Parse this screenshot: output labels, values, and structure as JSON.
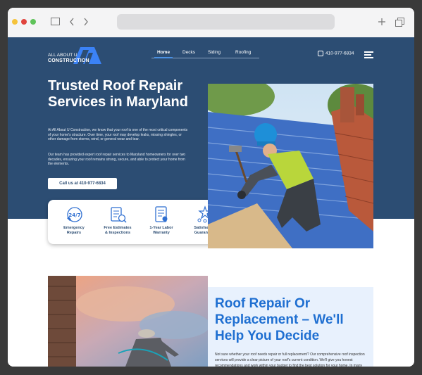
{
  "logo": {
    "line1": "ALL ABOUT U",
    "line2": "CONSTRUCTION"
  },
  "nav": {
    "items": [
      "Home",
      "Decks",
      "Siding",
      "Roofing"
    ]
  },
  "header": {
    "phone": "410-977-6834"
  },
  "hero": {
    "title": "Trusted Roof Repair Services in Maryland",
    "paragraph1": "At All About U Construction, we know that your roof is one of the most critical components of your home's structure. Over time, your roof may develop leaks, missing shingles, or other damage from storms, wind, or general wear and tear.",
    "paragraph2": "Our team has provided expert roof repair services to Maryland homeowners for over two decades, ensuring your roof remains strong, secure, and able to protect your home from the elements.",
    "cta_label": "Call us at 410-977-6834"
  },
  "features": [
    {
      "label": "Emergency\nRepairs",
      "icon": "24-7-phone-icon"
    },
    {
      "label": "Free Estimates\n& Inspections",
      "icon": "estimate-clipboard-icon"
    },
    {
      "label": "1-Year Labor\nWarranty",
      "icon": "warranty-document-icon"
    },
    {
      "label": "Satisfaction\nGuaranteed",
      "icon": "satisfaction-star-icon"
    }
  ],
  "section2": {
    "title": "Roof Repair Or Replacement – We'll Help You Decide",
    "paragraph": "Not sure whether your roof needs repair or full replacement? Our comprehensive roof inspection services will provide a clear picture of your roof's current condition. We'll give you honest recommendations and work within your budget to find the best solution for your home. In many cases,"
  },
  "colors": {
    "hero_bg": "#2c4d73",
    "accent_blue": "#1f6fd1",
    "card_bg": "#e8f1fd"
  }
}
